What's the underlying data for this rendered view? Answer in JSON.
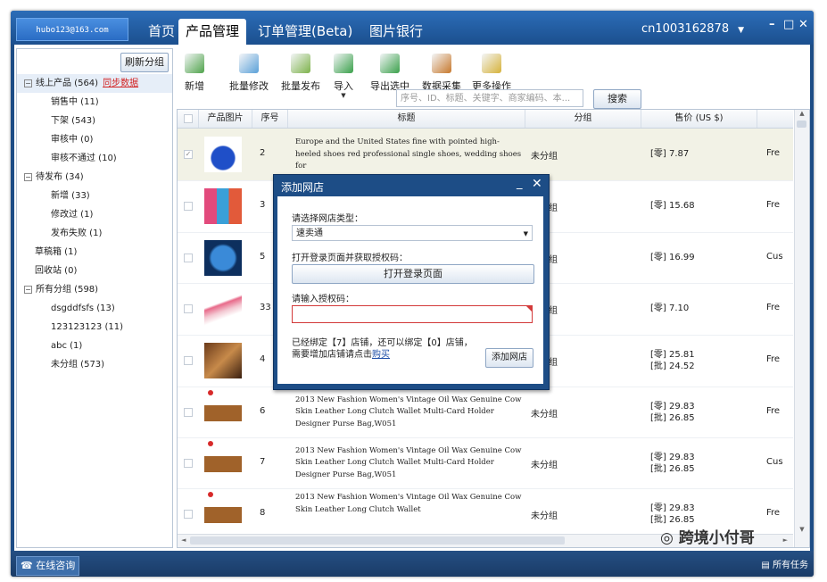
{
  "header": {
    "account": "hubo123@163.com",
    "tabs": [
      {
        "label": "首页"
      },
      {
        "label": "产品管理"
      },
      {
        "label": "订单管理(Beta)"
      },
      {
        "label": "图片银行"
      }
    ],
    "user": "cn1003162878",
    "window_controls": {
      "minimize": "–",
      "maximize": "□",
      "close": "✕"
    }
  },
  "sidebar": {
    "refresh_label": "刷新分组",
    "sync_label": "同步数据",
    "tree": [
      {
        "label": "线上产品 (564)",
        "level": 0,
        "expand": "⊟",
        "selected": true
      },
      {
        "label": "销售中 (11)",
        "level": 1
      },
      {
        "label": "下架 (543)",
        "level": 1
      },
      {
        "label": "审核中 (0)",
        "level": 1
      },
      {
        "label": "审核不通过 (10)",
        "level": 1
      },
      {
        "label": "待发布 (34)",
        "level": 0,
        "expand": "⊟"
      },
      {
        "label": "新增 (33)",
        "level": 1
      },
      {
        "label": "修改过 (1)",
        "level": 1
      },
      {
        "label": "发布失败 (1)",
        "level": 1
      },
      {
        "label": "草稿箱 (1)",
        "level": 0
      },
      {
        "label": "回收站 (0)",
        "level": 0
      },
      {
        "label": "所有分组 (598)",
        "level": 0,
        "expand": "⊟"
      },
      {
        "label": "dsgddfsfs (13)",
        "level": 1
      },
      {
        "label": "123123123 (11)",
        "level": 1
      },
      {
        "label": "abc (1)",
        "level": 1
      },
      {
        "label": "未分组 (573)",
        "level": 1
      }
    ]
  },
  "toolbar": {
    "buttons": [
      {
        "label": "新增",
        "icon": "add-doc-icon",
        "color": "#4fa34a",
        "dropdown": false
      },
      {
        "label": "批量修改",
        "icon": "batch-edit-icon",
        "color": "#5aa0d8",
        "dropdown": false
      },
      {
        "label": "批量发布",
        "icon": "batch-publish-icon",
        "color": "#7db24a",
        "dropdown": false
      },
      {
        "label": "导入",
        "icon": "import-icon",
        "color": "#3aa04a",
        "dropdown": true
      },
      {
        "label": "导出选中",
        "icon": "export-icon",
        "color": "#3aa04a",
        "dropdown": false
      },
      {
        "label": "数据采集",
        "icon": "data-collect-icon",
        "color": "#c7782c",
        "dropdown": false
      },
      {
        "label": "更多操作",
        "icon": "more-actions-icon",
        "color": "#d6b23a",
        "dropdown": true
      }
    ],
    "search_placeholder": "序号、ID、标题、关键字、商家编码、本...",
    "search_label": "搜索"
  },
  "grid": {
    "columns": [
      "产品图片",
      "序号",
      "标题",
      "分组",
      "售价 (US $)"
    ],
    "rows": [
      {
        "num": "2",
        "title": "Europe and the United States fine with pointed high-heeled shoes red professional single shoes, wedding shoes for",
        "group": "未分组",
        "price1": "[零] 7.87",
        "price2": "",
        "extra": "Fre",
        "selected": true,
        "thumb": "blue-heels",
        "dot": false
      },
      {
        "num": "3",
        "title": "",
        "group": "未分组",
        "price1": "[零] 15.68",
        "price2": "",
        "extra": "Fre",
        "selected": false,
        "thumb": "phone-cases",
        "dot": false
      },
      {
        "num": "5",
        "title": "",
        "group": "未分组",
        "price1": "[零] 16.99",
        "price2": "",
        "extra": "Cus",
        "selected": false,
        "thumb": "globe-t",
        "dot": false
      },
      {
        "num": "33",
        "title": "",
        "group": "未分组",
        "price1": "[零] 7.10",
        "price2": "",
        "extra": "Fre",
        "selected": false,
        "thumb": "bracelet",
        "dot": false
      },
      {
        "num": "4",
        "title": "",
        "group": "未分组",
        "price1": "[零] 25.81",
        "price2": "[批] 24.52",
        "extra": "Fre",
        "selected": false,
        "thumb": "sandals",
        "dot": false
      },
      {
        "num": "6",
        "title": "2013 New Fashion Women's Vintage Oil Wax Genuine Cow Skin Leather Long Clutch Wallet Multi-Card Holder Designer Purse Bag,W051",
        "group": "未分组",
        "price1": "[零] 29.83",
        "price2": "[批] 26.85",
        "extra": "Fre",
        "selected": false,
        "thumb": "wallet",
        "dot": true
      },
      {
        "num": "7",
        "title": "2013 New Fashion Women's Vintage Oil Wax Genuine Cow Skin Leather Long Clutch Wallet Multi-Card Holder Designer Purse Bag,W051",
        "group": "未分组",
        "price1": "[零] 29.83",
        "price2": "[批] 26.85",
        "extra": "Cus",
        "selected": false,
        "thumb": "wallet",
        "dot": true
      },
      {
        "num": "8",
        "title": "2013 New Fashion Women's Vintage Oil Wax Genuine Cow Skin Leather Long Clutch Wallet",
        "group": "未分组",
        "price1": "[零] 29.83",
        "price2": "[批] 26.85",
        "extra": "Fre",
        "selected": false,
        "thumb": "wallet",
        "dot": true
      }
    ]
  },
  "dialog": {
    "title": "添加网店",
    "store_type_label": "请选择网店类型：",
    "store_type_value": "速卖通",
    "open_login_label": "打开登录页面并获取授权码：",
    "open_login_button": "打开登录页面",
    "auth_code_label": "请输入授权码：",
    "info_text": "已经绑定【7】店铺，还可以绑定【0】店铺，需要增加店铺请点击",
    "buy_link": "购买",
    "add_button": "添加网店"
  },
  "statusbar": {
    "online": "在线咨询",
    "all_tasks": "所有任务",
    "watermark": "跨境小付哥"
  },
  "colors": {
    "window_blue": "#1d4d86",
    "accent_red": "#d21f1f"
  }
}
